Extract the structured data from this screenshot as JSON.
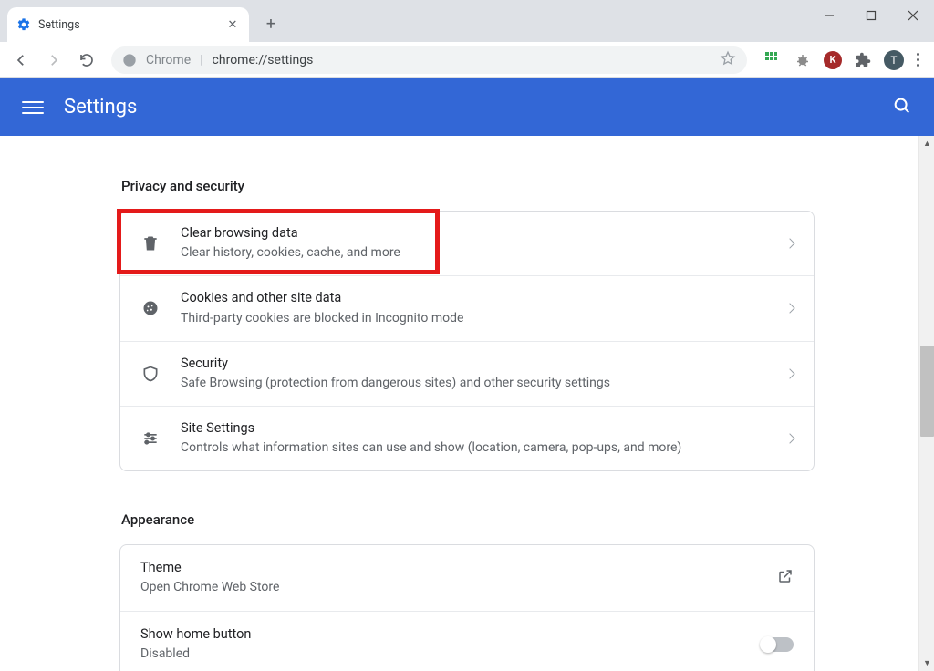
{
  "tab": {
    "title": "Settings"
  },
  "omnibox": {
    "label": "Chrome",
    "url": "chrome://settings"
  },
  "profile": {
    "initial": "T"
  },
  "ext_k": {
    "initial": "K"
  },
  "header": {
    "title": "Settings"
  },
  "sections": {
    "privacy": {
      "title": "Privacy and security",
      "rows": [
        {
          "title": "Clear browsing data",
          "sub": "Clear history, cookies, cache, and more"
        },
        {
          "title": "Cookies and other site data",
          "sub": "Third-party cookies are blocked in Incognito mode"
        },
        {
          "title": "Security",
          "sub": "Safe Browsing (protection from dangerous sites) and other security settings"
        },
        {
          "title": "Site Settings",
          "sub": "Controls what information sites can use and show (location, camera, pop-ups, and more)"
        }
      ]
    },
    "appearance": {
      "title": "Appearance",
      "rows": [
        {
          "title": "Theme",
          "sub": "Open Chrome Web Store"
        },
        {
          "title": "Show home button",
          "sub": "Disabled"
        }
      ]
    }
  }
}
